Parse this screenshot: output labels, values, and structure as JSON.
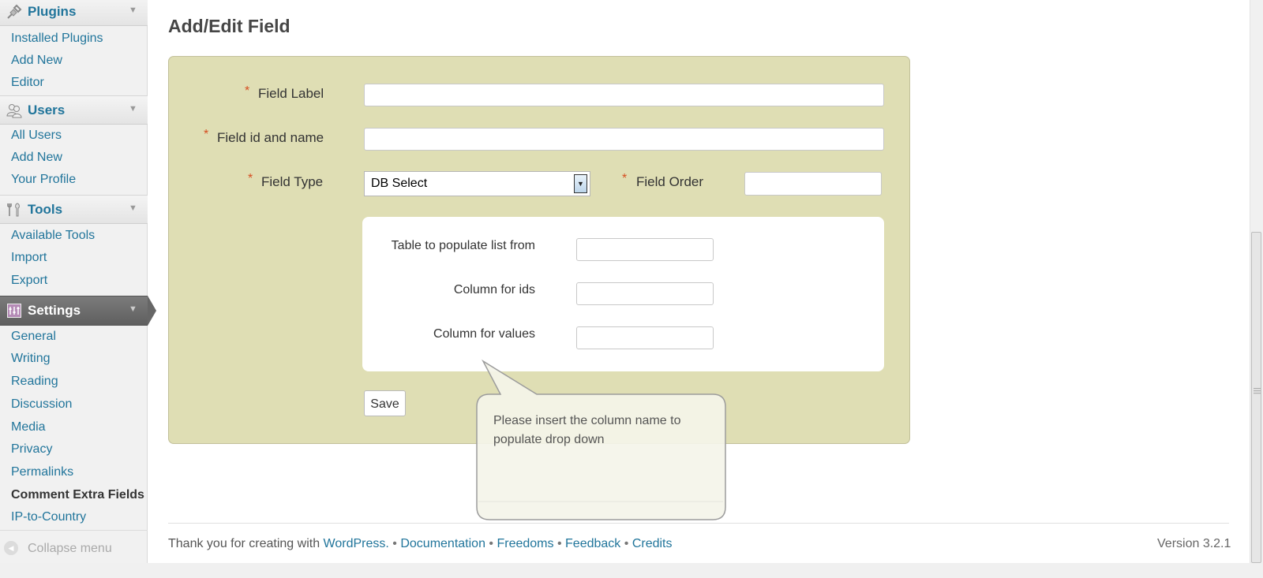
{
  "sidebar": {
    "plugins": {
      "title": "Plugins",
      "items": [
        "Installed Plugins",
        "Add New",
        "Editor"
      ]
    },
    "users": {
      "title": "Users",
      "items": [
        "All Users",
        "Add New",
        "Your Profile"
      ]
    },
    "tools": {
      "title": "Tools",
      "items": [
        "Available Tools",
        "Import",
        "Export"
      ]
    },
    "settings": {
      "title": "Settings",
      "items": [
        "General",
        "Writing",
        "Reading",
        "Discussion",
        "Media",
        "Privacy",
        "Permalinks",
        "Comment Extra Fields",
        "IP-to-Country"
      ],
      "current_item": "Comment Extra Fields"
    },
    "collapse_label": "Collapse menu"
  },
  "main": {
    "title": "Add/Edit Field",
    "form": {
      "required_mark": "*",
      "field_label": {
        "label": "Field Label",
        "value": ""
      },
      "field_id": {
        "label": "Field id and name",
        "value": ""
      },
      "field_type": {
        "label": "Field Type",
        "selected": "DB Select"
      },
      "field_order": {
        "label": "Field Order",
        "value": ""
      },
      "db_options": {
        "table": {
          "label": "Table to populate list from",
          "value": ""
        },
        "column_ids": {
          "label": "Column for ids",
          "value": ""
        },
        "column_values": {
          "label": "Column for values",
          "value": ""
        }
      },
      "save_label": "Save"
    },
    "tooltip": "Please insert the column name to populate drop down"
  },
  "footer": {
    "thanks_prefix": "Thank you for creating with",
    "wordpress": "WordPress.",
    "sep": "•",
    "documentation": "Documentation",
    "freedoms": "Freedoms",
    "feedback": "Feedback",
    "credits": "Credits",
    "version": "Version 3.2.1"
  },
  "colors": {
    "link": "#21759b",
    "form_panel": "#dfdeb4",
    "required": "#d54e21",
    "active_menu": "#6d6d6d"
  },
  "icons": {
    "plugins": "plug-icon",
    "users": "users-icon",
    "tools": "tools-icon",
    "settings": "settings-icon",
    "collapse": "collapse-arrow-icon"
  }
}
